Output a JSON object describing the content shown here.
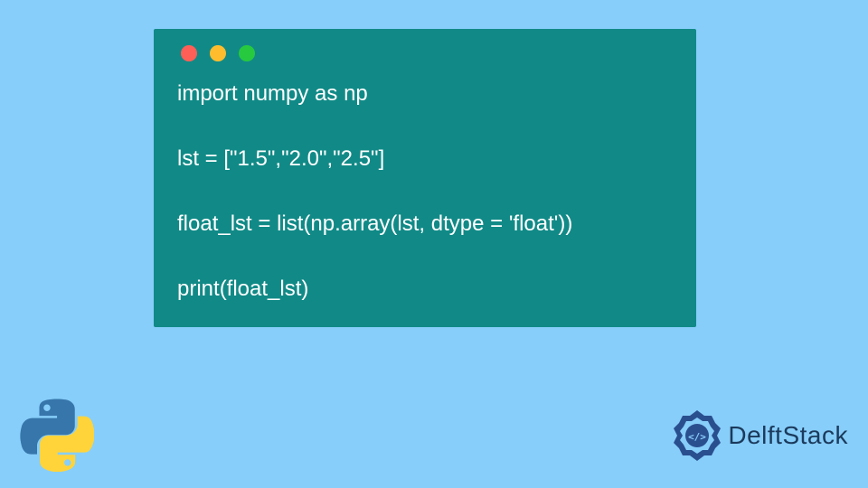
{
  "code": {
    "line1": "import numpy as np",
    "line2": "",
    "line3": "lst = [\"1.5\",\"2.0\",\"2.5\"]",
    "line4": "",
    "line5": "float_lst = list(np.array(lst, dtype = 'float'))",
    "line6": "",
    "line7": "print(float_lst)"
  },
  "brand": {
    "name": "DelftStack"
  },
  "colors": {
    "background": "#87cefa",
    "codeWindow": "#118a87",
    "codeText": "#ffffff",
    "dotRed": "#ff5f56",
    "dotYellow": "#ffbd2e",
    "dotGreen": "#27c93f",
    "brandText": "#1b3a5c",
    "brandIcon": "#2a4f8f",
    "pythonBlue": "#3776ab",
    "pythonYellow": "#ffd43b"
  }
}
